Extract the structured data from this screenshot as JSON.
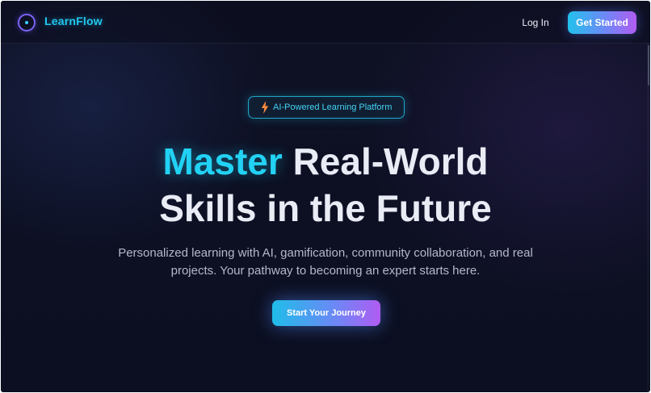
{
  "header": {
    "brand": "LearnFlow",
    "login_label": "Log In",
    "get_started_label": "Get Started"
  },
  "hero": {
    "badge_text": "AI-Powered Learning Platform",
    "headline_accent": "Master",
    "headline_line1_rest": "Real-World",
    "headline_line2": "Skills in the Future",
    "subtext": "Personalized learning with AI, gamification, community collaboration, and real projects. Your pathway to becoming an expert starts here.",
    "cta_label": "Start Your Journey"
  },
  "icons": {
    "logo": "circle-logo-icon",
    "badge": "lightning-bolt-icon"
  },
  "colors": {
    "background": "#0d1023",
    "brand": "#22c7ef",
    "accent": "#22d2f4",
    "gradient_start": "#21c1ec",
    "gradient_end": "#b05cf2"
  }
}
